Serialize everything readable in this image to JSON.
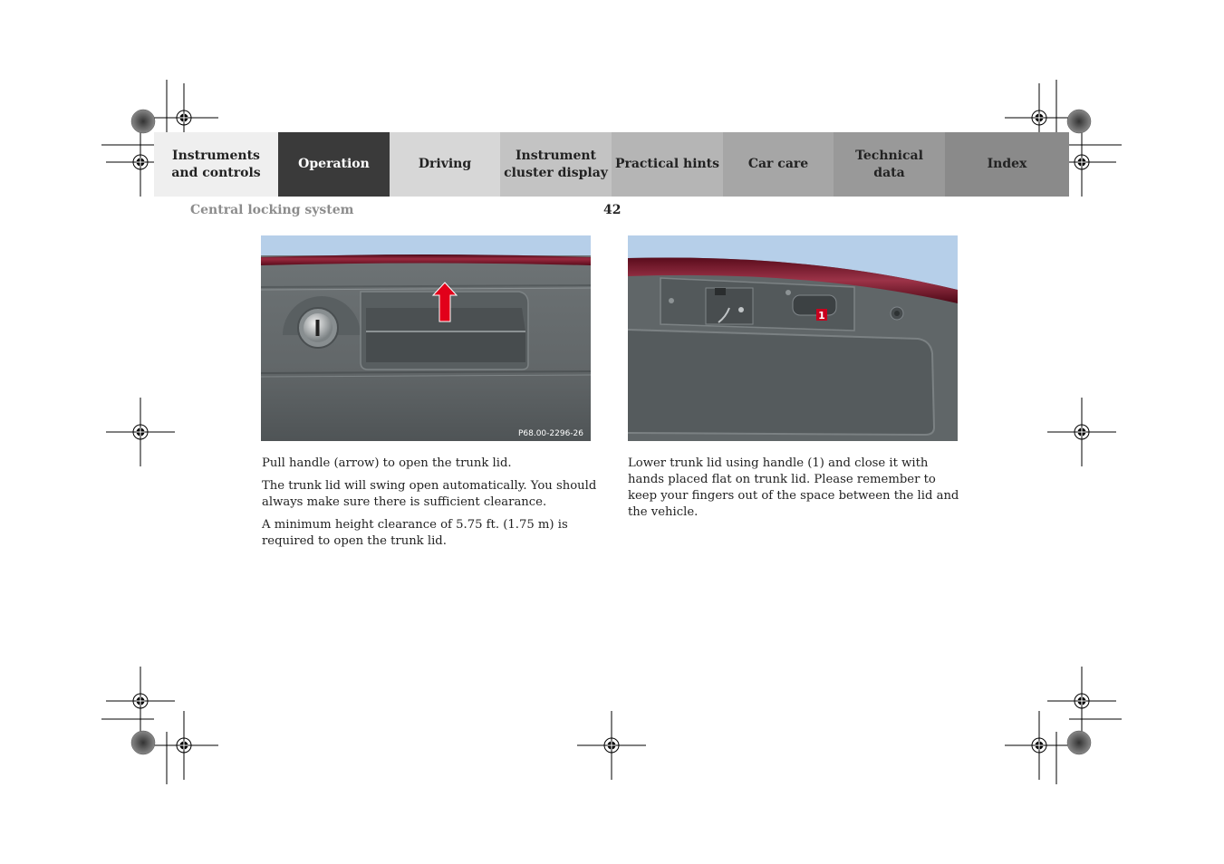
{
  "nav": {
    "tabs": [
      {
        "label": "Instruments and controls",
        "lines": [
          "Instruments",
          "and controls"
        ],
        "active": false,
        "bg": "#efefef",
        "fg": "#222222"
      },
      {
        "label": "Operation",
        "lines": [
          "Operation"
        ],
        "active": true,
        "bg": "#3a3a3a",
        "fg": "#ffffff"
      },
      {
        "label": "Driving",
        "lines": [
          "Driving"
        ],
        "active": false,
        "bg": "#d7d7d7",
        "fg": "#222222"
      },
      {
        "label": "Instrument cluster display",
        "lines": [
          "Instrument",
          "cluster display"
        ],
        "active": false,
        "bg": "#c3c3c3",
        "fg": "#222222"
      },
      {
        "label": "Practical hints",
        "lines": [
          "Practical hints"
        ],
        "active": false,
        "bg": "#b5b5b5",
        "fg": "#222222"
      },
      {
        "label": "Car care",
        "lines": [
          "Car care"
        ],
        "active": false,
        "bg": "#a6a6a6",
        "fg": "#222222"
      },
      {
        "label": "Technical data",
        "lines": [
          "Technical",
          "data"
        ],
        "active": false,
        "bg": "#999999",
        "fg": "#222222"
      },
      {
        "label": "Index",
        "lines": [
          "Index"
        ],
        "active": false,
        "bg": "#8a8a8a",
        "fg": "#222222"
      }
    ]
  },
  "header": {
    "section_title": "Central locking system",
    "page_number": "42"
  },
  "figures": {
    "left": {
      "code": "P68.00-2296-26",
      "arrow_color": "#e2001a"
    },
    "right": {
      "callout": "1",
      "callout_color": "#c8001e"
    }
  },
  "text": {
    "left": [
      "Pull handle (arrow) to open the trunk lid.",
      "The trunk lid will swing open automatically. You should always make sure there is sufficient clearance.",
      "A minimum height clearance of 5.75 ft. (1.75 m) is required to open the trunk lid."
    ],
    "right": [
      "Lower trunk lid using handle (1) and close it with hands placed flat on trunk lid. Please remember to keep your fingers out of the space between the lid and the vehicle."
    ]
  },
  "colors": {
    "sky": "#b6cfe9",
    "body_red": "#7b1428",
    "panel_gray": "#5f6567"
  }
}
